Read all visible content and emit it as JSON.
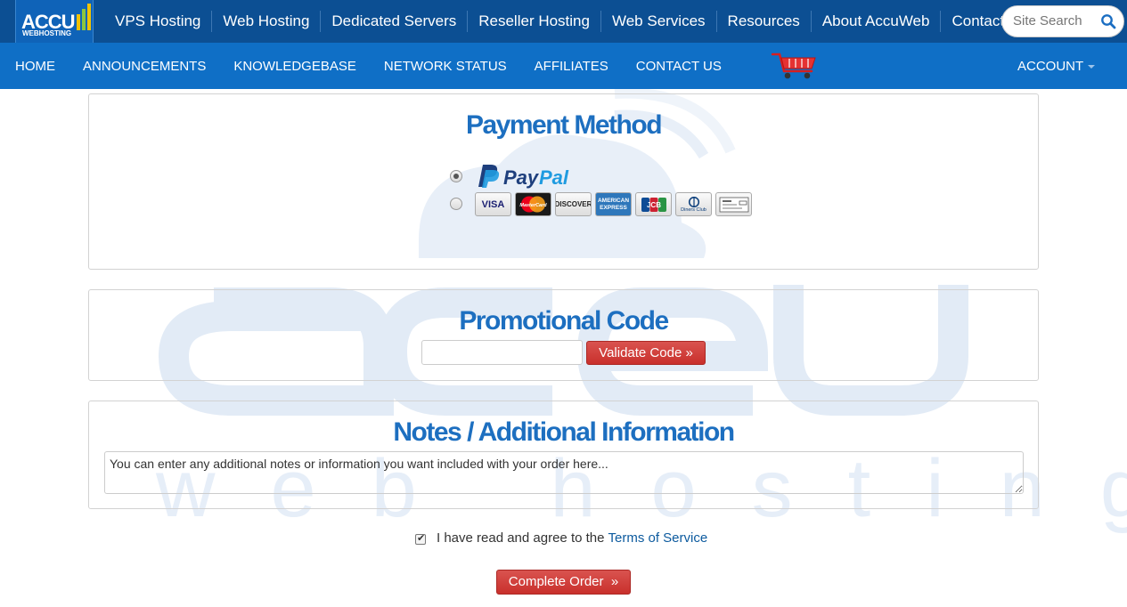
{
  "brand": {
    "logo_text": "ACCU",
    "logo_subtext": "WEBHOSTING"
  },
  "top_nav": [
    "VPS Hosting",
    "Web Hosting",
    "Dedicated Servers",
    "Reseller Hosting",
    "Web Services",
    "Resources",
    "About AccuWeb",
    "Contact"
  ],
  "search": {
    "placeholder": "Site Search",
    "icon": "search-icon"
  },
  "sub_nav": [
    "Home",
    "Announcements",
    "Knowledgebase",
    "Network Status",
    "Affiliates",
    "Contact Us"
  ],
  "cart": {
    "icon": "shopping-cart-icon"
  },
  "account": {
    "label": "ACCOUNT"
  },
  "payment": {
    "title": "Payment Method",
    "options": [
      {
        "name": "PayPal",
        "selected": true
      },
      {
        "name": "Credit Card",
        "selected": false
      }
    ],
    "paypal_text": "PayPal",
    "cards": [
      "VISA",
      "MasterCard",
      "DISCOVER",
      "AMERICAN EXPRESS",
      "JCB",
      "Diners Club",
      "eCheck"
    ]
  },
  "promo": {
    "title": "Promotional Code",
    "input_value": "",
    "button_label": "Validate Code »"
  },
  "notes": {
    "title": "Notes / Additional Information",
    "value": "You can enter any additional notes or information you want included with your order here..."
  },
  "tos": {
    "checked": true,
    "text": "I have read and agree to the",
    "link": "Terms of Service"
  },
  "complete": {
    "label": "Complete Order  »"
  },
  "colors": {
    "top_bar": "#0c4f93",
    "sub_bar": "#0f6fc6",
    "heading": "#1d6fc0",
    "button_red": "#d9534f",
    "watermark": "#e4edf7"
  }
}
